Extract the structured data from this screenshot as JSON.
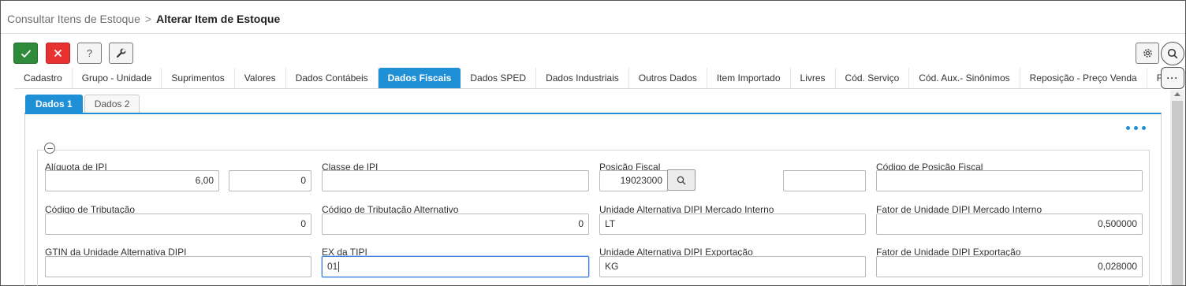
{
  "breadcrumb": {
    "parent": "Consultar Itens de Estoque",
    "separator": ">",
    "current": "Alterar Item de Estoque"
  },
  "toolbar": {
    "confirm_icon": "check-icon",
    "cancel_icon": "close-icon",
    "help_label": "?",
    "settings_icon": "wrench-icon",
    "colors": {
      "confirm": "#2e8b3a",
      "cancel": "#e83232",
      "accent": "#1f8fd6"
    }
  },
  "more_label": "···",
  "tabs": [
    {
      "label": "Cadastro"
    },
    {
      "label": "Grupo - Unidade"
    },
    {
      "label": "Suprimentos"
    },
    {
      "label": "Valores"
    },
    {
      "label": "Dados Contábeis"
    },
    {
      "label": "Dados Fiscais",
      "active": true
    },
    {
      "label": "Dados SPED"
    },
    {
      "label": "Dados Industriais"
    },
    {
      "label": "Outros Dados"
    },
    {
      "label": "Item Importado"
    },
    {
      "label": "Livres"
    },
    {
      "label": "Cód. Serviço"
    },
    {
      "label": "Cód. Aux.- Sinônimos"
    },
    {
      "label": "Reposição - Preço Venda"
    },
    {
      "label": "Fabricante"
    }
  ],
  "subtabs": [
    {
      "label": "Dados 1",
      "active": true
    },
    {
      "label": "Dados 2"
    }
  ],
  "fields": {
    "aliquota_ipi": {
      "label": "Alíquota de IPI",
      "value": "6,00",
      "value2": "0"
    },
    "classe_ipi": {
      "label": "Classe de IPI",
      "value": ""
    },
    "posicao_fiscal": {
      "label": "Posição Fiscal",
      "value": "19023000",
      "extra": ""
    },
    "codigo_posicao_fiscal": {
      "label": "Código de Posição Fiscal",
      "value": ""
    },
    "codigo_tributacao": {
      "label": "Código de Tributação",
      "value": "0"
    },
    "codigo_tributacao_alt": {
      "label": "Código de Tributação Alternativo",
      "value": "0"
    },
    "unid_alt_dipi_mi": {
      "label": "Unidade Alternativa DIPI Mercado Interno",
      "value": "LT"
    },
    "fator_unid_dipi_mi": {
      "label": "Fator de Unidade DIPI Mercado Interno",
      "value": "0,500000"
    },
    "gtin_unid_alt_dipi": {
      "label": "GTIN da Unidade Alternativa DIPI",
      "value": ""
    },
    "ex_tipi": {
      "label": "EX da TIPI",
      "value": "01"
    },
    "unid_alt_dipi_exp": {
      "label": "Unidade Alternativa DIPI Exportação",
      "value": "KG"
    },
    "fator_unid_dipi_exp": {
      "label": "Fator de Unidade DIPI Exportação",
      "value": "0,028000"
    }
  }
}
